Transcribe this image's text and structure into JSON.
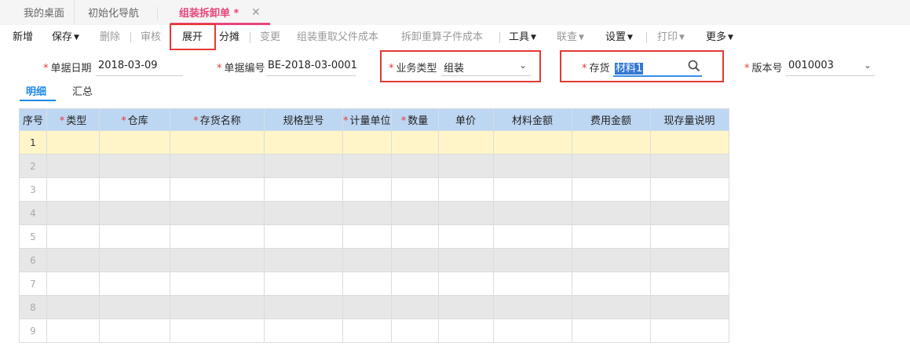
{
  "tabs": [
    {
      "label": "我的桌面"
    },
    {
      "label": "初始化导航"
    },
    {
      "label": "组装拆卸单 *"
    }
  ],
  "toolbar": {
    "new": "新增",
    "save": "保存",
    "delete": "删除",
    "audit": "审核",
    "expand": "展开",
    "allocate": "分摊",
    "change": "变更",
    "recalc_parent": "组装重取父件成本",
    "recalc_child": "拆卸重算子件成本",
    "tools": "工具",
    "linked": "联查",
    "settings": "设置",
    "print": "打印",
    "more": "更多"
  },
  "form": {
    "date": {
      "label": "单据日期",
      "value": "2018-03-09"
    },
    "number": {
      "label": "单据编号",
      "value": "BE-2018-03-0001"
    },
    "biz_type": {
      "label": "业务类型",
      "value": "组装"
    },
    "inventory": {
      "label": "存货",
      "value": "材料1"
    },
    "version": {
      "label": "版本号",
      "value": "0010003"
    }
  },
  "detail_tabs": [
    {
      "label": "明细"
    },
    {
      "label": "汇总"
    }
  ],
  "grid": {
    "columns": [
      {
        "label": "序号",
        "required": false
      },
      {
        "label": "类型",
        "required": true
      },
      {
        "label": "仓库",
        "required": true
      },
      {
        "label": "存货名称",
        "required": true
      },
      {
        "label": "规格型号",
        "required": false
      },
      {
        "label": "计量单位",
        "required": true
      },
      {
        "label": "数量",
        "required": true
      },
      {
        "label": "单价",
        "required": false
      },
      {
        "label": "材料金额",
        "required": false
      },
      {
        "label": "费用金额",
        "required": false
      },
      {
        "label": "现存量说明",
        "required": false
      }
    ],
    "row_numbers": [
      "1",
      "2",
      "3",
      "4",
      "5",
      "6",
      "7",
      "8",
      "9"
    ]
  },
  "colors": {
    "accent": "#e8457a",
    "header_bg": "#bdd7f2",
    "selected_row": "#fff5c8",
    "highlight_box": "#e53935",
    "link_blue": "#1e88e5"
  }
}
